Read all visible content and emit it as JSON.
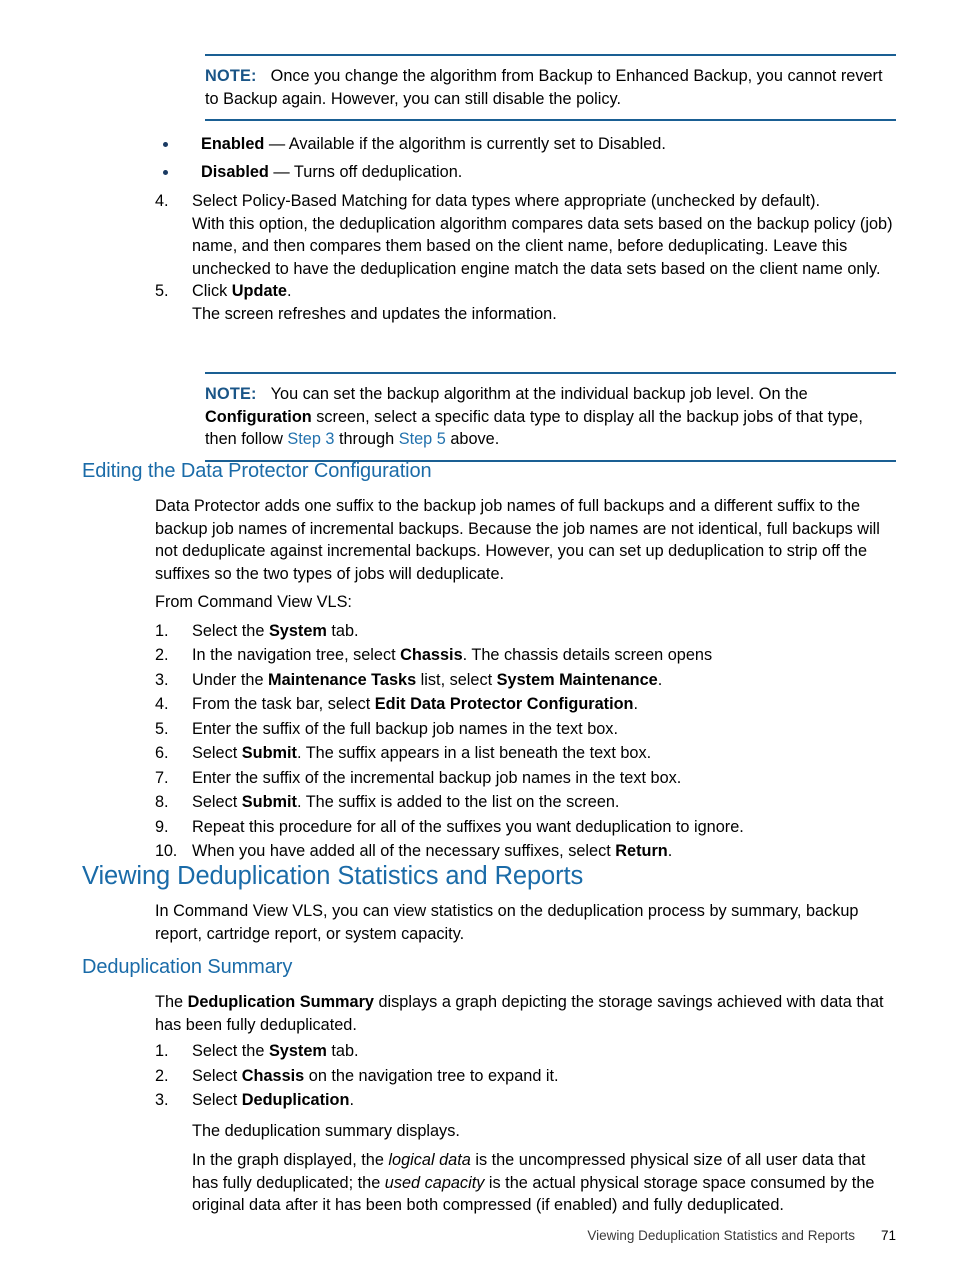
{
  "note_1": {
    "label": "NOTE:",
    "text": "Once you change the algorithm from Backup to Enhanced Backup, you cannot revert to Backup again. However, you can still disable the policy."
  },
  "bullets": [
    {
      "term": "Enabled",
      "dash": " — ",
      "text": "Available if the algorithm is currently set to Disabled."
    },
    {
      "term": "Disabled",
      "dash": " — ",
      "text": "Turns off deduplication."
    }
  ],
  "steps_top": {
    "item4": {
      "num": "4.",
      "text": "Select Policy-Based Matching for data types where appropriate (unchecked by default)."
    },
    "item4_sub": "With this option, the deduplication algorithm compares data sets based on the backup policy (job) name, and then compares them based on the client name, before deduplicating. Leave this unchecked to have the deduplication engine match the data sets based on the client name only.",
    "item5": {
      "num": "5.",
      "pre": "Click ",
      "bold": "Update",
      "post": "."
    },
    "item5_sub": "The screen refreshes and updates the information."
  },
  "note_2": {
    "label": "NOTE:",
    "part1": "You can set the backup algorithm at the individual backup job level. On the ",
    "bold1": "Configuration",
    "part2": " screen, select a specific data type to display all the backup jobs of that type, then follow ",
    "link1": "Step 3",
    "part3": " through ",
    "link2": "Step 5",
    "part4": " above."
  },
  "section_editing": {
    "heading": "Editing the Data Protector Configuration",
    "paragraph": "Data Protector adds one suffix to the backup job names of full backups and a different suffix to the backup job names of incremental backups. Because the job names are not identical, full backups will not deduplicate against incremental backups. However, you can set up deduplication to strip off the suffixes so the two types of jobs will deduplicate.",
    "lead_in": "From Command View VLS:",
    "steps": [
      {
        "num": "1.",
        "pre": "Select the ",
        "bold": "System",
        "post": " tab."
      },
      {
        "num": "2.",
        "pre": "In the navigation tree, select ",
        "bold": "Chassis",
        "post": ". The chassis details screen opens"
      },
      {
        "num": "3.",
        "pre": "Under the ",
        "bold": "Maintenance Tasks",
        "post": " list, select ",
        "bold2": "System Maintenance",
        "post2": "."
      },
      {
        "num": "4.",
        "pre": "From the task bar, select ",
        "bold": "Edit Data Protector Configuration",
        "post": "."
      },
      {
        "num": "5.",
        "pre": "Enter the suffix of the full backup job names in the text box.",
        "bold": "",
        "post": ""
      },
      {
        "num": "6.",
        "pre": "Select ",
        "bold": "Submit",
        "post": ". The suffix appears in a list beneath the text box."
      },
      {
        "num": "7.",
        "pre": "Enter the suffix of the incremental backup job names in the text box.",
        "bold": "",
        "post": ""
      },
      {
        "num": "8.",
        "pre": "Select ",
        "bold": "Submit",
        "post": ". The suffix is added to the list on the screen."
      },
      {
        "num": "9.",
        "pre": "Repeat this procedure for all of the suffixes you want deduplication to ignore.",
        "bold": "",
        "post": ""
      },
      {
        "num": "10.",
        "pre": "When you have added all of the necessary suffixes, select ",
        "bold": "Return",
        "post": "."
      }
    ]
  },
  "section_viewing": {
    "heading": "Viewing Deduplication Statistics and Reports",
    "paragraph": "In Command View VLS, you can view statistics on the deduplication process by summary, backup report, cartridge report, or system capacity."
  },
  "section_summary": {
    "heading": "Deduplication Summary",
    "intro_pre": "The ",
    "intro_bold": "Deduplication Summary",
    "intro_post": " displays a graph depicting the storage savings achieved with data that has been fully deduplicated.",
    "steps": [
      {
        "num": "1.",
        "pre": "Select the ",
        "bold": "System",
        "post": " tab."
      },
      {
        "num": "2.",
        "pre": "Select ",
        "bold": "Chassis",
        "post": " on the navigation tree to expand it."
      },
      {
        "num": "3.",
        "pre": "Select ",
        "bold": "Deduplication",
        "post": "."
      }
    ],
    "after_steps": "The deduplication summary displays.",
    "graph_pre": "In the graph displayed, the ",
    "graph_em1": "logical data",
    "graph_mid": " is the uncompressed physical size of all user data that has fully deduplicated; the ",
    "graph_em2": "used capacity",
    "graph_post": " is the actual physical storage space consumed by the original data after it has been both compressed (if enabled) and fully deduplicated."
  },
  "footer": {
    "title": "Viewing Deduplication Statistics and Reports",
    "page_number": "71"
  },
  "colors": {
    "heading_blue": "#1a6ba8",
    "note_rule_blue": "#1a5f93",
    "note_label_blue": "#1a5587",
    "link_blue": "#2272ae",
    "bullet_navy": "#1a3a63"
  }
}
